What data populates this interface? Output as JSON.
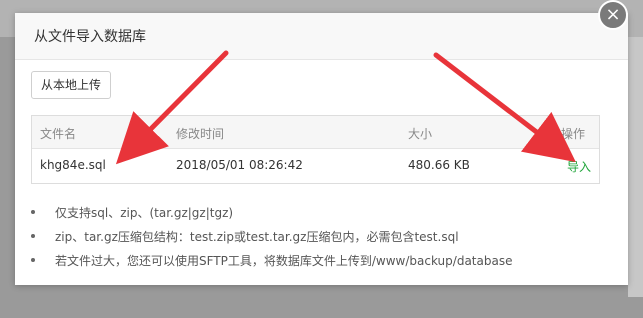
{
  "dialog": {
    "title": "从文件导入数据库",
    "close_label": "×",
    "upload_button_label": "从本地上传"
  },
  "table": {
    "headers": [
      "文件名",
      "修改时间",
      "大小",
      "操作"
    ],
    "rows": [
      {
        "name": "khg84e.sql",
        "modified": "2018/05/01 08:26:42",
        "size": "480.66 KB",
        "action": "导入"
      }
    ]
  },
  "notes": [
    "仅支持sql、zip、(tar.gz|gz|tgz)",
    "zip、tar.gz压缩包结构：test.zip或test.tar.gz压缩包内，必需包含test.sql",
    "若文件过大，您还可以使用SFTP工具，将数据库文件上传到/www/backup/database"
  ],
  "colors": {
    "accent": "#20a53a",
    "annotation_arrow": "#e8343a"
  }
}
